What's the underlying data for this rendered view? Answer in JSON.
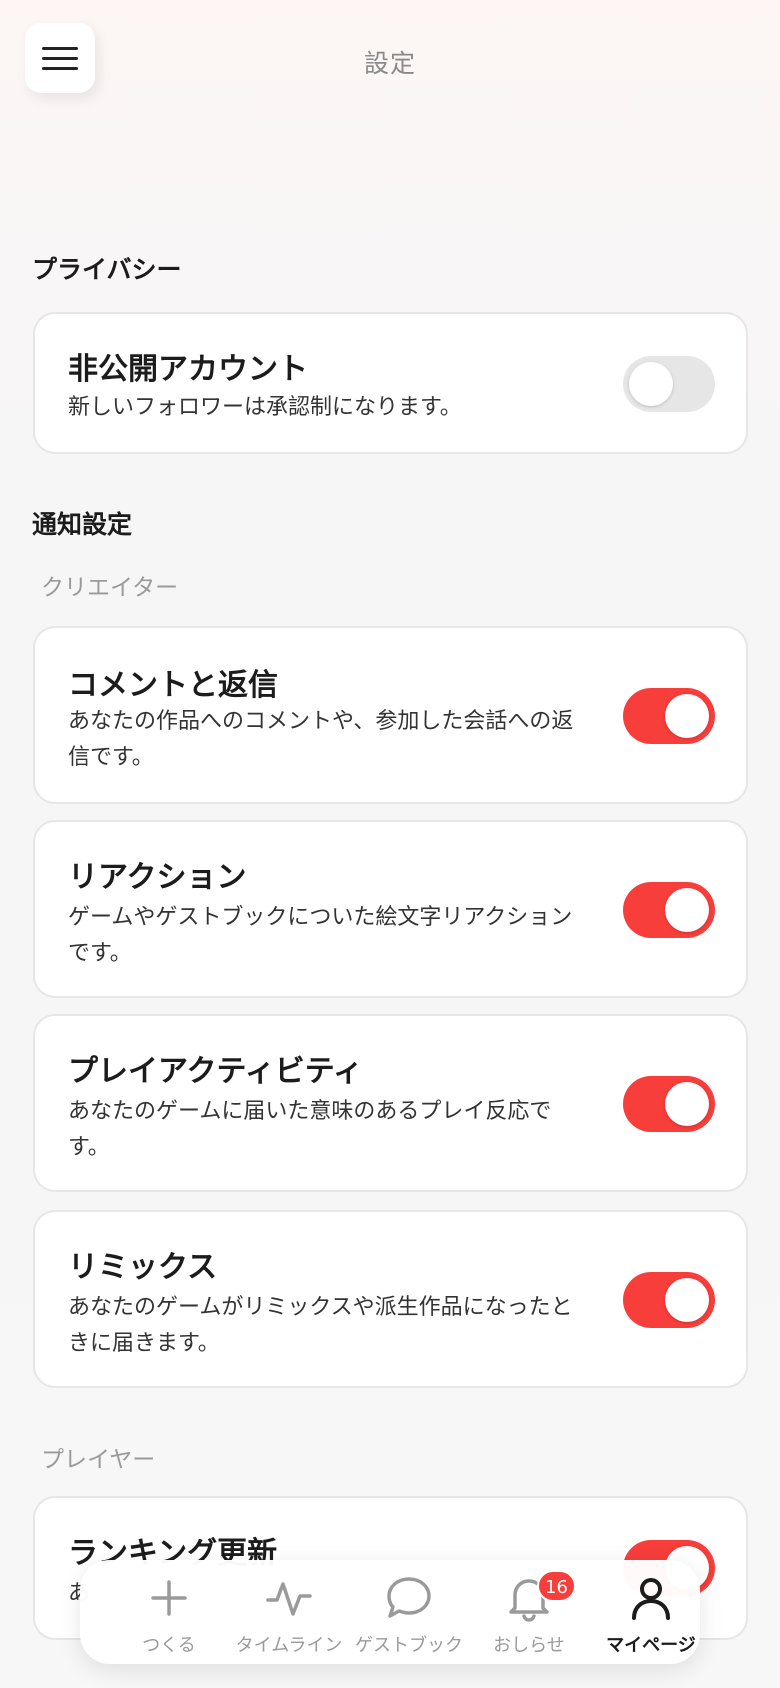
{
  "header": {
    "title": "設定",
    "menu_icon": "hamburger-icon"
  },
  "privacy": {
    "heading": "プライバシー",
    "private_account": {
      "title": "非公開アカウント",
      "description": "新しいフォロワーは承認制になります。",
      "enabled": false
    }
  },
  "notifications": {
    "heading": "通知設定",
    "creator_group": {
      "label": "クリエイター",
      "items": [
        {
          "title": "コメントと返信",
          "description": "あなたの作品へのコメントや、参加した会話への返信です。",
          "enabled": true
        },
        {
          "title": "リアクション",
          "description": "ゲームやゲストブックについた絵文字リアクションです。",
          "enabled": true
        },
        {
          "title": "プレイアクティビティ",
          "description": "あなたのゲームに届いた意味のあるプレイ反応です。",
          "enabled": true
        },
        {
          "title": "リミックス",
          "description": "あなたのゲームがリミックスや派生作品になったときに届きます。",
          "enabled": true
        }
      ]
    },
    "player_group": {
      "label": "プレイヤー",
      "items": [
        {
          "title": "ランキング更新",
          "description": "あ",
          "enabled": true
        }
      ]
    }
  },
  "tabbar": {
    "tabs": [
      {
        "label": "つくる",
        "icon": "plus-icon"
      },
      {
        "label": "タイムライン",
        "icon": "activity-icon"
      },
      {
        "label": "ゲストブック",
        "icon": "chat-bubble-icon"
      },
      {
        "label": "おしらせ",
        "icon": "bell-icon",
        "badge": "16"
      },
      {
        "label": "マイページ",
        "icon": "person-icon",
        "active": true
      }
    ]
  },
  "colors": {
    "accent": "#f73e3b",
    "toggle_off": "#e6e6e6"
  }
}
